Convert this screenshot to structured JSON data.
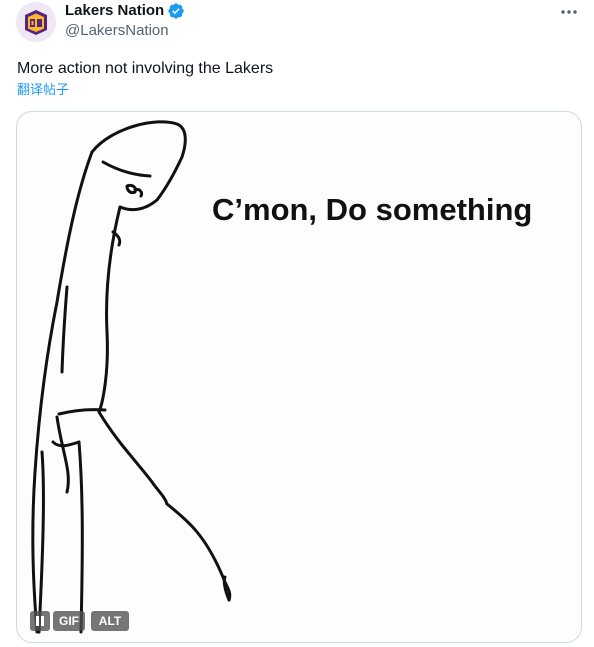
{
  "author": {
    "display_name": "Lakers Nation",
    "handle": "@LakersNation",
    "avatar_icon": "lakers-nation-logo-icon",
    "verified_icon": "verified-badge-icon",
    "verified_color": "#1d9bf0"
  },
  "more_icon": "more-horizontal-icon",
  "tweet": {
    "text": "More action not involving the Lakers",
    "translate_label": "翻译帖子"
  },
  "media": {
    "caption": "C’mon, Do something",
    "pause_icon": "pause-icon",
    "gif_label": "GIF",
    "alt_label": "ALT"
  },
  "colors": {
    "link": "#1d9bf0",
    "secondary_text": "#536471",
    "border": "#cfd9de"
  }
}
